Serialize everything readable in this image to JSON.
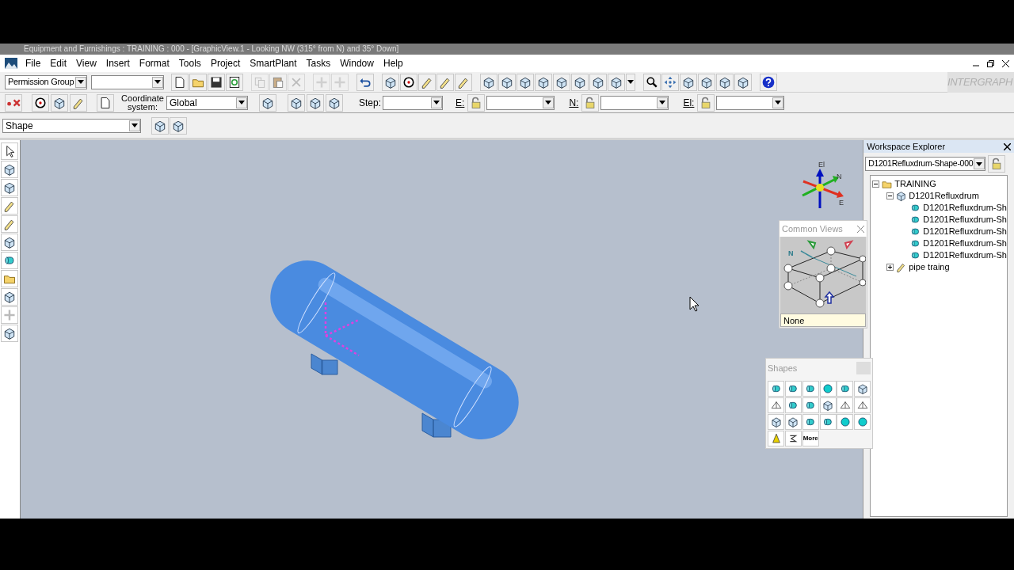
{
  "window": {
    "title": "Equipment and Furnishings : TRAINING : 000 - [GraphicView.1 - Looking NW (315° from N) and 35° Down]"
  },
  "menu": [
    "File",
    "Edit",
    "View",
    "Insert",
    "Format",
    "Tools",
    "Project",
    "SmartPlant",
    "Tasks",
    "Window",
    "Help"
  ],
  "toolbar": {
    "permission_group": "Permission Group",
    "logo": "INTERGRAPH"
  },
  "pinpoint_bar": {
    "coordinate_label": "Coordinate system:",
    "coordinate_value": "Global",
    "step_label": "Step:",
    "e_label": "E:",
    "n_label": "N:",
    "el_label": "El:"
  },
  "locate_filter": {
    "value": "Shape"
  },
  "axis_triad": {
    "up": "El",
    "north": "N",
    "east": "E"
  },
  "common_views": {
    "title": "Common Views",
    "north": "N",
    "selection": "None"
  },
  "shapes_palette": {
    "title": "Shapes",
    "more": "More"
  },
  "workspace_explorer": {
    "title": "Workspace Explorer",
    "filter": "D1201Refluxdrum-Shape-000",
    "tree": [
      {
        "label": "TRAINING",
        "kind": "folder",
        "expanded": true,
        "children": [
          {
            "label": "D1201Refluxdrum",
            "kind": "equipment",
            "expanded": true,
            "children": [
              {
                "label": "D1201Refluxdrum-Sh",
                "kind": "shape"
              },
              {
                "label": "D1201Refluxdrum-Sh",
                "kind": "shape"
              },
              {
                "label": "D1201Refluxdrum-Sh",
                "kind": "shape"
              },
              {
                "label": "D1201Refluxdrum-Sh",
                "kind": "shape"
              },
              {
                "label": "D1201Refluxdrum-Sh",
                "kind": "shape"
              }
            ]
          },
          {
            "label": "pipe traing",
            "kind": "pipe",
            "expanded": false
          }
        ]
      }
    ]
  }
}
